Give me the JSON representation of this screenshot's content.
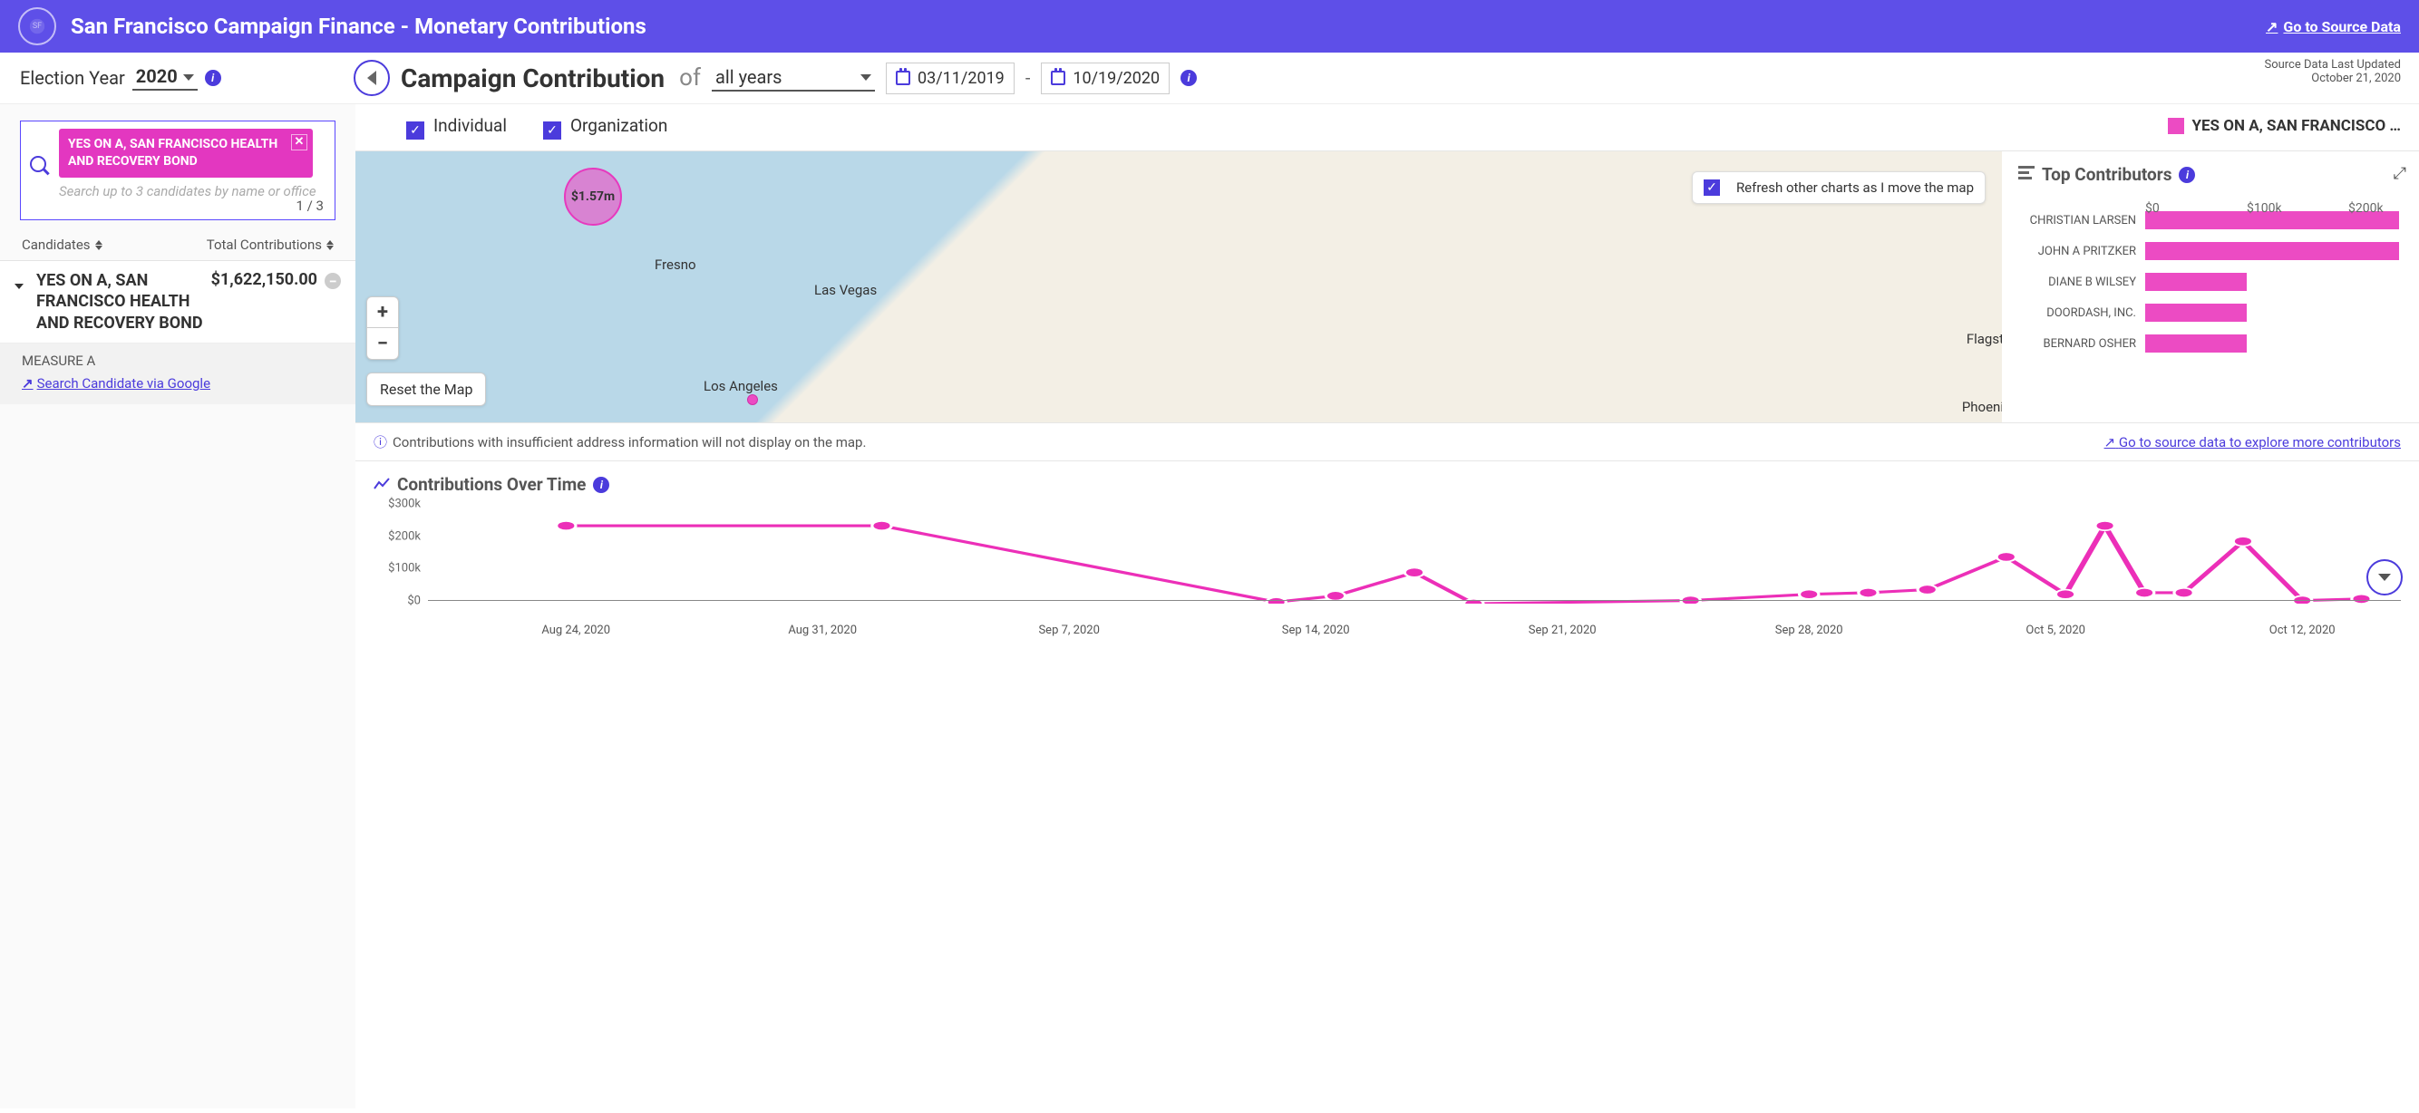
{
  "header": {
    "title": "San Francisco Campaign Finance - Monetary Contributions",
    "source_link": "Go to Source Data",
    "last_updated_label": "Source Data Last Updated",
    "last_updated_value": "October 21, 2020"
  },
  "election": {
    "label": "Election Year",
    "year": "2020"
  },
  "campaign": {
    "title": "Campaign Contribution",
    "of": "of",
    "year_select": "all years",
    "date_from": "03/11/2019",
    "date_sep": "-",
    "date_to": "10/19/2020"
  },
  "search": {
    "chip": "YES ON A, SAN FRANCISCO HEALTH AND RECOVERY BOND",
    "placeholder": "Search up to 3 candidates by name or office",
    "count": "1 / 3"
  },
  "candidates": {
    "col1": "Candidates",
    "col2": "Total Contributions",
    "row": {
      "name": "YES ON A, SAN FRANCISCO HEALTH AND RECOVERY BOND",
      "amount": "$1,622,150.00",
      "measure": "MEASURE A",
      "google_link": "Search Candidate via Google"
    }
  },
  "filters": {
    "individual": "Individual",
    "organization": "Organization",
    "legend": "YES ON A, SAN FRANCISCO …"
  },
  "map": {
    "bubble_amount": "$1.57m",
    "refresh_label": "Refresh other charts as I move the map",
    "reset_label": "Reset the Map",
    "cities": {
      "fresno": "Fresno",
      "las_vegas": "Las Vegas",
      "los_angeles": "Los Angeles",
      "flagstaff": "Flagst",
      "phoenix": "Phoeni"
    },
    "footer_note": "Contributions with insufficient address information will not display on the map.",
    "source_link": "Go to source data to explore more contributors"
  },
  "top_contributors": {
    "title": "Top Contributors",
    "ticks": [
      "$0",
      "$100k",
      "$200k"
    ]
  },
  "time_chart": {
    "title": "Contributions Over Time"
  },
  "chart_data": [
    {
      "type": "bar",
      "name": "top_contributors",
      "categories": [
        "CHRISTIAN LARSEN",
        "JOHN A PRITZKER",
        "DIANE B WILSEY",
        "DOORDASH, INC.",
        "BERNARD OSHER"
      ],
      "values": [
        250000,
        250000,
        100000,
        100000,
        100000
      ],
      "xlim": [
        0,
        250000
      ],
      "xlabel": "",
      "ylabel": ""
    },
    {
      "type": "line",
      "name": "contributions_over_time",
      "x_labels": [
        "Aug 24, 2020",
        "Aug 31, 2020",
        "Sep 7, 2020",
        "Sep 14, 2020",
        "Sep 21, 2020",
        "Sep 28, 2020",
        "Oct 5, 2020",
        "Oct 12, 2020"
      ],
      "y_ticks": [
        "$0",
        "$100k",
        "$200k",
        "$300k"
      ],
      "ylim": [
        0,
        320000
      ],
      "points": [
        {
          "x": 0.07,
          "y": 250000
        },
        {
          "x": 0.23,
          "y": 250000
        },
        {
          "x": 0.43,
          "y": 5000
        },
        {
          "x": 0.46,
          "y": 25000
        },
        {
          "x": 0.5,
          "y": 100000
        },
        {
          "x": 0.53,
          "y": 0
        },
        {
          "x": 0.64,
          "y": 10000
        },
        {
          "x": 0.7,
          "y": 30000
        },
        {
          "x": 0.73,
          "y": 35000
        },
        {
          "x": 0.76,
          "y": 45000
        },
        {
          "x": 0.8,
          "y": 150000
        },
        {
          "x": 0.83,
          "y": 30000
        },
        {
          "x": 0.85,
          "y": 250000
        },
        {
          "x": 0.87,
          "y": 35000
        },
        {
          "x": 0.89,
          "y": 35000
        },
        {
          "x": 0.92,
          "y": 200000
        },
        {
          "x": 0.95,
          "y": 10000
        },
        {
          "x": 0.98,
          "y": 15000
        }
      ]
    }
  ]
}
